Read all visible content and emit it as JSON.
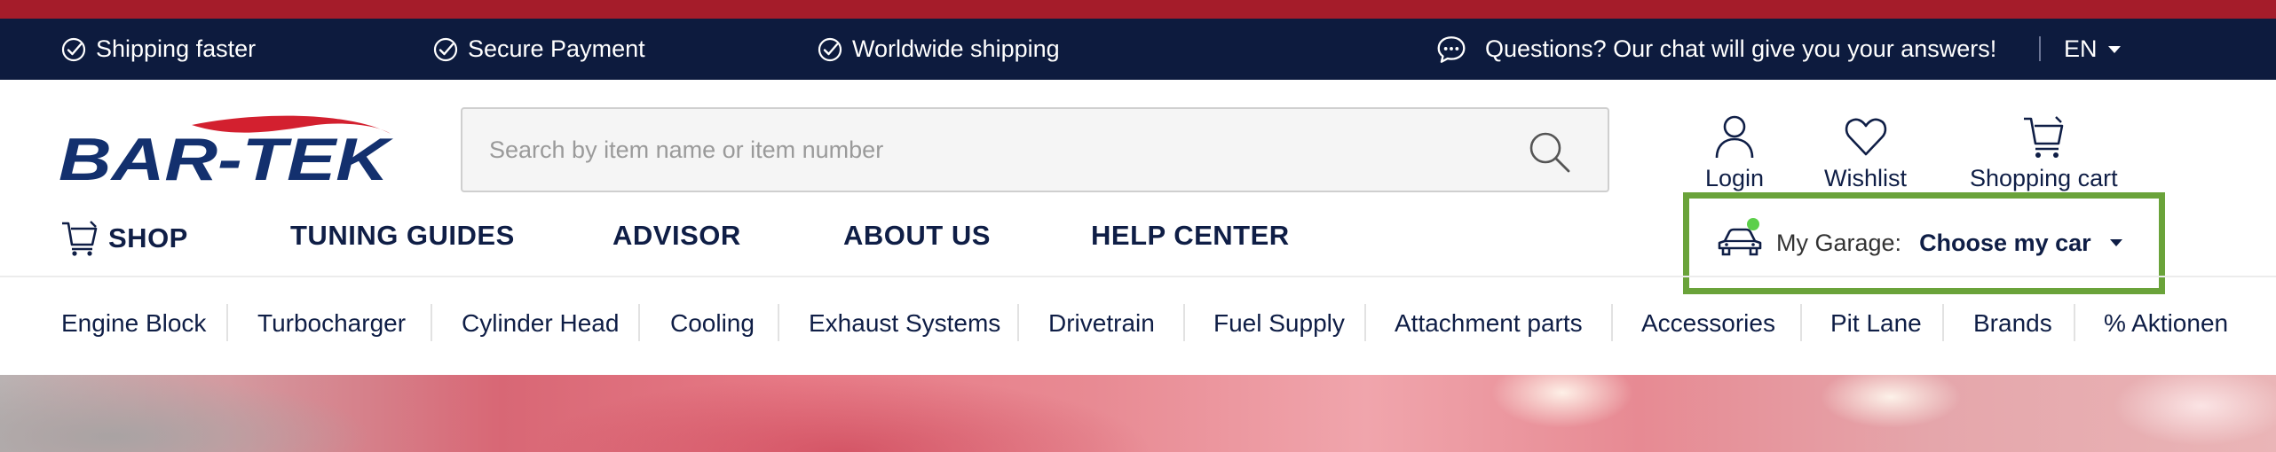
{
  "usp_bar": {
    "items": [
      {
        "label": "Shipping faster",
        "icon": "check-circle-icon"
      },
      {
        "label": "Secure Payment",
        "icon": "check-circle-icon"
      },
      {
        "label": "Worldwide shipping",
        "icon": "check-circle-icon"
      }
    ],
    "chat": {
      "label": "Questions? Our chat will give you your answers!",
      "icon": "chat-bubble-icon"
    },
    "language": {
      "selected": "EN"
    }
  },
  "header": {
    "logo_alt": "BAR-TEK",
    "search": {
      "placeholder": "Search by item name or item number",
      "value": ""
    },
    "actions": {
      "login": "Login",
      "wishlist": "Wishlist",
      "cart": "Shopping cart"
    }
  },
  "nav": {
    "shop": "SHOP",
    "tuning_guides": "TUNING GUIDES",
    "advisor": "ADVISOR",
    "about_us": "ABOUT US",
    "help_center": "HELP CENTER"
  },
  "garage": {
    "label": "My Garage:",
    "value": "Choose my car"
  },
  "categories": [
    "Engine Block",
    "Turbocharger",
    "Cylinder Head",
    "Cooling",
    "Exhaust Systems",
    "Drivetrain",
    "Fuel Supply",
    "Attachment parts",
    "Accessories",
    "Pit Lane",
    "Brands",
    "% Aktionen"
  ],
  "colors": {
    "brand_navy": "#0d1b3e",
    "brand_red": "#a51c2a",
    "garage_highlight": "#6aa33a"
  }
}
